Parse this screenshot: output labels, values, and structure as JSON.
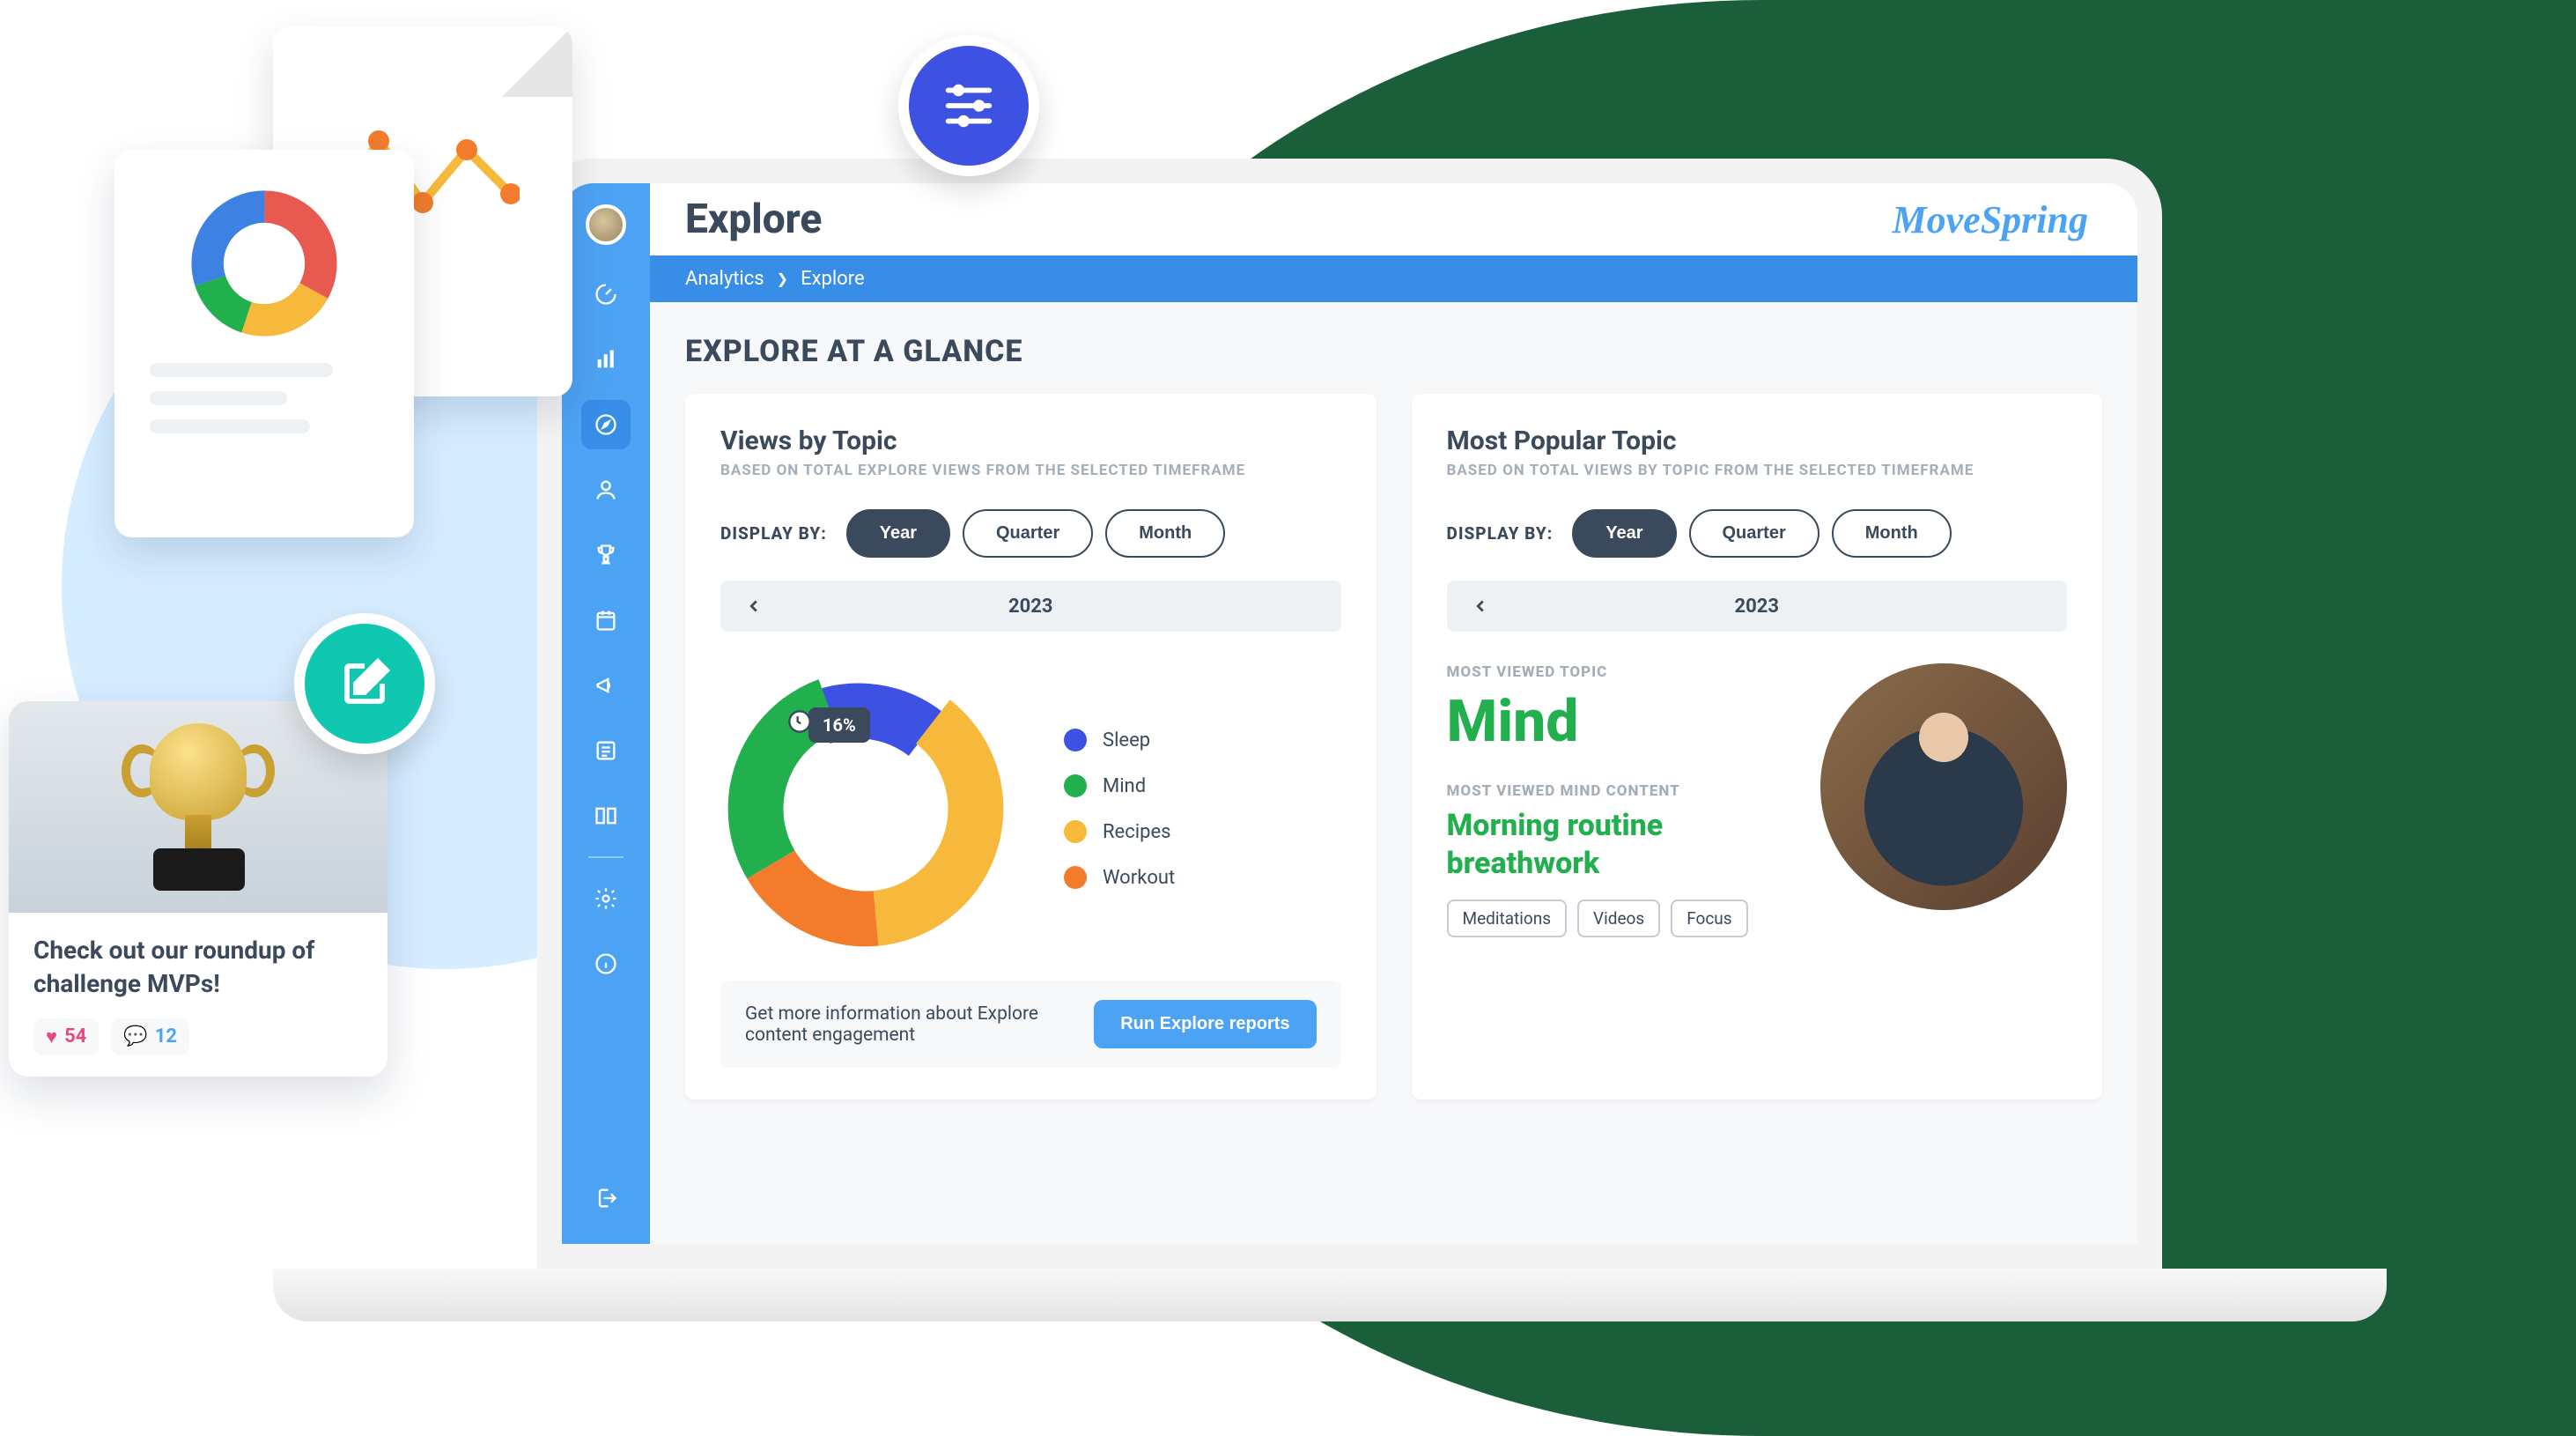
{
  "brand": "MoveSpring",
  "page_title": "Explore",
  "breadcrumb": {
    "parent": "Analytics",
    "current": "Explore"
  },
  "section_heading": "EXPLORE AT A GLANCE",
  "display_by_label": "DISPLAY BY:",
  "display_options": [
    "Year",
    "Quarter",
    "Month"
  ],
  "period_label": "2023",
  "views_card": {
    "title": "Views by Topic",
    "subtitle": "BASED ON TOTAL EXPLORE VIEWS FROM THE SELECTED TIMEFRAME",
    "tooltip": "16%",
    "legend": [
      {
        "label": "Sleep",
        "color": "#3d52e3"
      },
      {
        "label": "Mind",
        "color": "#21b04d"
      },
      {
        "label": "Recipes",
        "color": "#f6b93b"
      },
      {
        "label": "Workout",
        "color": "#f27c2b"
      }
    ],
    "reports_text": "Get more information about Explore content engagement",
    "reports_button": "Run Explore reports"
  },
  "popular_card": {
    "title": "Most Popular Topic",
    "subtitle": "BASED ON TOTAL VIEWS BY TOPIC FROM THE SELECTED TIMEFRAME",
    "most_viewed_label": "MOST VIEWED TOPIC",
    "most_viewed_topic": "Mind",
    "most_viewed_content_label": "MOST VIEWED MIND CONTENT",
    "most_viewed_content": "Morning routine breathwork",
    "tags": [
      "Meditations",
      "Videos",
      "Focus"
    ]
  },
  "mvp_card": {
    "text": "Check out our roundup of challenge MVPs!",
    "hearts": "54",
    "comments": "12"
  },
  "sidebar_icons": [
    "dashboard-icon",
    "analytics-icon",
    "explore-icon",
    "users-icon",
    "trophy-icon",
    "calendar-icon",
    "announce-icon",
    "list-icon",
    "library-icon",
    "settings-icon",
    "info-icon",
    "logout-icon"
  ],
  "chart_data": {
    "type": "pie",
    "title": "Views by Topic",
    "categories": [
      "Sleep",
      "Mind",
      "Recipes",
      "Workout"
    ],
    "values": [
      16,
      28,
      38,
      18
    ],
    "colors": [
      "#3d52e3",
      "#21b04d",
      "#f6b93b",
      "#f27c2b"
    ],
    "highlighted_slice": {
      "category": "Sleep",
      "value_pct": 16
    }
  }
}
